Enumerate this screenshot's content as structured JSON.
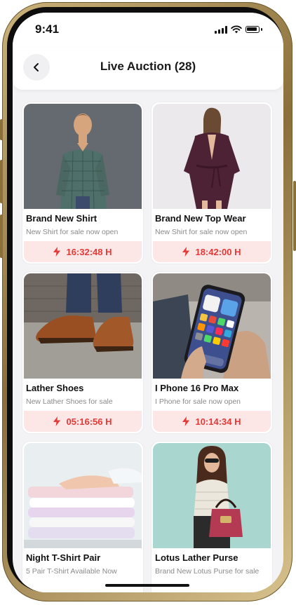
{
  "status_bar": {
    "time": "9:41",
    "icons": [
      "signal-icon",
      "wifi-icon",
      "battery-icon"
    ]
  },
  "header": {
    "back_icon": "chevron-left-icon",
    "title": "Live Auction (28)"
  },
  "colors": {
    "accent": "#e53935",
    "timer_bg": "#fde6e6",
    "screen_bg": "#f3f3f5"
  },
  "auctions": [
    {
      "title": "Brand New Shirt",
      "subtitle": "New Shirt for sale now open",
      "timer": "16:32:48 H",
      "image": "man-in-plaid-shirt"
    },
    {
      "title": "Brand New Top Wear",
      "subtitle": "New Shirt for sale now open",
      "timer": "18:42:00 H",
      "image": "woman-in-velvet-robe"
    },
    {
      "title": "Lather Shoes",
      "subtitle": "New Lather Shoes for sale",
      "timer": "05:16:56 H",
      "image": "brown-leather-shoes"
    },
    {
      "title": "I Phone 16 Pro Max",
      "subtitle": "I Phone for sale now open",
      "timer": "10:14:34 H",
      "image": "hand-holding-phone"
    },
    {
      "title": "Night T-Shirt Pair",
      "subtitle": "5 Pair T-Shirt Available Now",
      "timer": "",
      "image": "folded-t-shirts"
    },
    {
      "title": "Lotus Lather Purse",
      "subtitle": "Brand New Lotus Purse for sale",
      "timer": "",
      "image": "woman-with-purse"
    }
  ]
}
